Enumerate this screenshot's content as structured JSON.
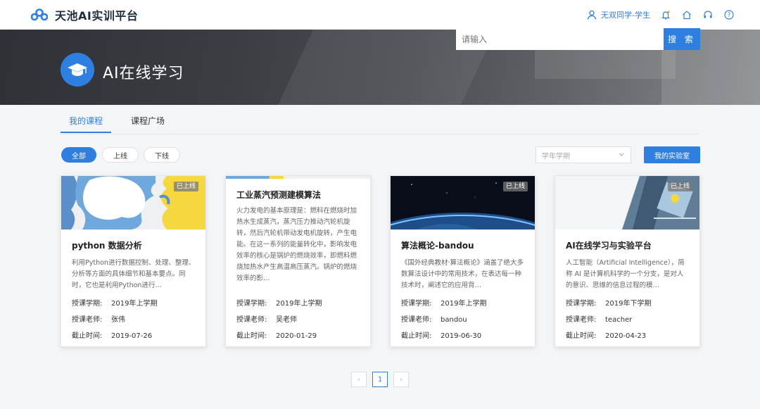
{
  "app": {
    "title": "天池AI实训平台"
  },
  "user": {
    "name": "无双同学-学生"
  },
  "icons": [
    "user-icon",
    "bell-icon",
    "home-icon",
    "headset-icon",
    "help-icon"
  ],
  "banner": {
    "title": "AI在线学习",
    "search_placeholder": "请输入",
    "search_label": "搜 索"
  },
  "tabs": [
    {
      "label": "我的课程",
      "active": true
    },
    {
      "label": "课程广场",
      "active": false
    }
  ],
  "filters": {
    "all": "全部",
    "online": "上线",
    "offline": "下线",
    "term_placeholder": "学年学期",
    "lab_label": "我的实验室"
  },
  "labels": {
    "term": "授课学期:",
    "teacher": "授课老师:",
    "deadline": "截止时间:"
  },
  "courses": [
    {
      "title": "python 数据分析",
      "status": "已上线",
      "desc": "利用Python进行数据控制、处理、整理、分析等方面的具体细节和基本要点。同时，它也是利用Python进行…",
      "term": "2019年上学期",
      "teacher": "张伟",
      "deadline": "2019-07-26"
    },
    {
      "title": "工业蒸汽预测建模算法",
      "status": "",
      "desc": "火力发电的基本原理是：燃料在燃烧时加热水生成蒸汽，蒸汽压力推动汽轮机旋转，然后汽轮机带动发电机旋转，产生电能。在这一系列的能量转化中，影响发电效率的核心是锅炉的燃烧效率，即燃料燃烧加热水产生高温高压蒸汽。锅炉的燃烧效率的影…",
      "term": "2019年上学期",
      "teacher": "吴老师",
      "deadline": "2020-01-29"
    },
    {
      "title": "算法概论-bandou",
      "status": "已上线",
      "desc": "《国外经典教材·算法概论》涵盖了绝大多数算法设计中的常用技术，在表达每一种技术时，阐述它的应用背…",
      "term": "2019年上学期",
      "teacher": "bandou",
      "deadline": "2019-06-30"
    },
    {
      "title": "AI在线学习与实验平台",
      "status": "已上线",
      "desc": "人工智能（Artificial Intelligence），简称 AI 是计算机科学的一个分支，是对人的意识、思维的信息过程的模…",
      "term": "2019年下学期",
      "teacher": "teacher",
      "deadline": "2020-04-23"
    }
  ],
  "pagination": {
    "prev": "‹",
    "current": "1",
    "next": "›"
  },
  "colors": {
    "primary": "#2f7fe0",
    "banner": "#3a3d42",
    "status_bg": "#787878"
  }
}
